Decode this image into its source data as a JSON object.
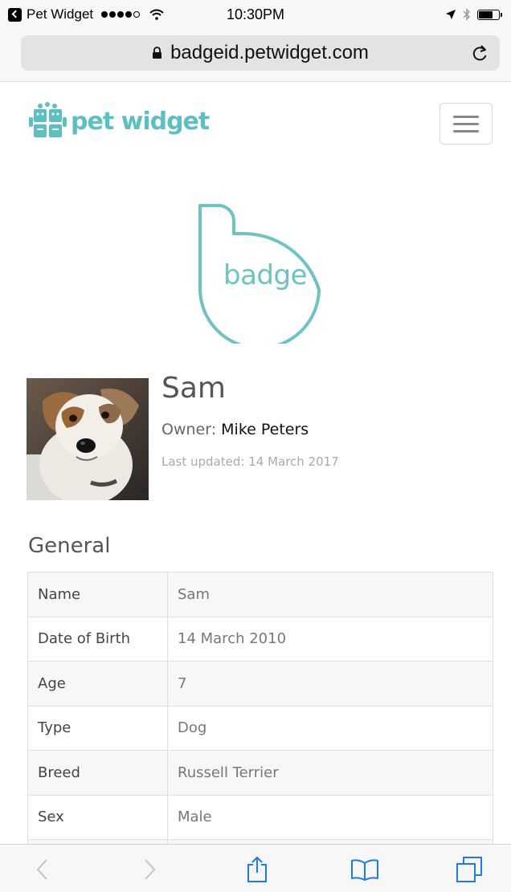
{
  "status_bar": {
    "carrier": "Pet Widget",
    "time": "10:30PM"
  },
  "browser": {
    "url": "badgeid.petwidget.com"
  },
  "site": {
    "logo_text": "pet widget",
    "badge_text": "badge",
    "accent_color": "#5bc0c2"
  },
  "profile": {
    "name": "Sam",
    "owner_label": "Owner:",
    "owner_name": "Mike Peters",
    "last_updated": "Last updated: 14 March 2017"
  },
  "general": {
    "title": "General",
    "rows": [
      {
        "label": "Name",
        "value": "Sam"
      },
      {
        "label": "Date of Birth",
        "value": "14 March 2010"
      },
      {
        "label": "Age",
        "value": "7"
      },
      {
        "label": "Type",
        "value": "Dog"
      },
      {
        "label": "Breed",
        "value": "Russell Terrier"
      },
      {
        "label": "Sex",
        "value": "Male"
      },
      {
        "label": "",
        "value": ""
      }
    ]
  },
  "toolbar": {
    "icons": [
      "back-icon",
      "forward-icon",
      "share-icon",
      "bookmarks-icon",
      "tabs-icon"
    ]
  }
}
